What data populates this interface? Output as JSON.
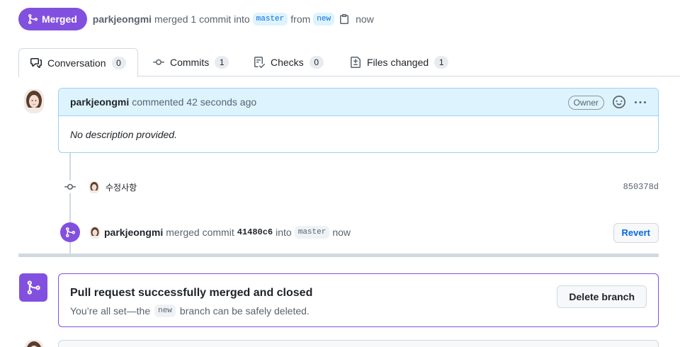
{
  "header": {
    "state_label": "Merged",
    "author": "parkjeongmi",
    "merged_text": "merged 1 commit into",
    "base_branch": "master",
    "from_text": "from",
    "head_branch": "new",
    "time": "now"
  },
  "tabs": [
    {
      "label": "Conversation",
      "count": "0",
      "icon": "comment-discussion-icon"
    },
    {
      "label": "Commits",
      "count": "1",
      "icon": "git-commit-icon"
    },
    {
      "label": "Checks",
      "count": "0",
      "icon": "checklist-icon"
    },
    {
      "label": "Files changed",
      "count": "1",
      "icon": "file-diff-icon"
    }
  ],
  "comment": {
    "author": "parkjeongmi",
    "meta": "commented 42 seconds ago",
    "role_badge": "Owner",
    "body": "No description provided."
  },
  "commit": {
    "message": "수정사항",
    "sha": "850378d"
  },
  "merge_event": {
    "author": "parkjeongmi",
    "text": "merged commit",
    "sha": "41480c6",
    "into": "into",
    "branch": "master",
    "time": "now",
    "revert_label": "Revert"
  },
  "merged_box": {
    "title": "Pull request successfully merged and closed",
    "desc_prefix": "You’re all set—the",
    "branch": "new",
    "desc_suffix": "branch can be safely deleted.",
    "delete_label": "Delete branch"
  },
  "colors": {
    "merged_purple": "#8250df",
    "link_blue": "#0969da",
    "comment_header_bg": "#ddf4ff"
  }
}
